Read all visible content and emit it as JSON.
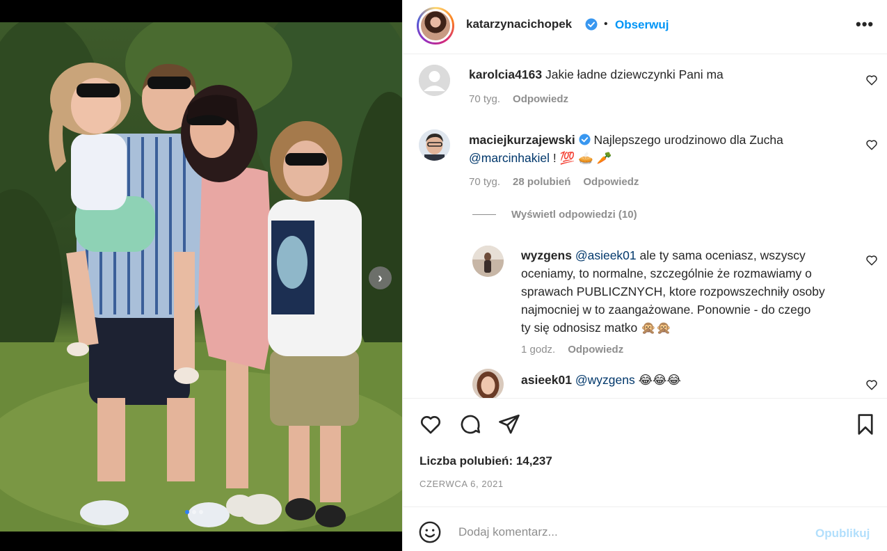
{
  "post": {
    "author": "katarzynacichopek",
    "separator": "•",
    "follow_label": "Obserwuj",
    "more_label": "•••"
  },
  "comments": [
    {
      "user": "karolcia4163",
      "text": "Jakie ładne dziewczynki Pani ma",
      "time": "70 tyg.",
      "reply_label": "Odpowiedz"
    },
    {
      "user": "maciejkurzajewski",
      "verified": true,
      "text_line1": "Najlepszego urodzinowo dla Zucha",
      "mention": "@marcinhakiel",
      "text_after_mention": " ! 💯 🥧 🥕",
      "time": "70 tyg.",
      "likes": "28 polubień",
      "reply_label": "Odpowiedz",
      "view_replies": "Wyświetl odpowiedzi (10)"
    }
  ],
  "replies": [
    {
      "user": "wyzgens",
      "mention": "@asieek01",
      "text_line1": " ale ty sama oceniasz, wszyscy",
      "text_line2": "oceniamy, to normalne, szczególnie że rozmawiamy o",
      "text_line3": "sprawach PUBLICZNYCH, ktore rozpowszechniły osoby",
      "text_line4": "najmocniej w to zaangażowane. Ponownie - do czego",
      "text_line5": "ty się odnosisz matko 🙊🙊",
      "time": "1 godz.",
      "reply_label": "Odpowiedz"
    },
    {
      "user": "asieek01",
      "mention": "@wyzgens",
      "text_after_mention": " 😂😂😂"
    }
  ],
  "stats": {
    "likes_label": "Liczba polubień: 14,237",
    "date": "CZERWCA 6, 2021"
  },
  "comment_box": {
    "placeholder": "Dodaj komentarz...",
    "publish_label": "Opublikuj"
  },
  "colors": {
    "accent": "#0095f6",
    "verified": "#3897f0",
    "muted": "#8e8e8e",
    "publish_disabled": "#b2dffc",
    "carousel_active": "#2f7ff3"
  },
  "icons": {
    "next": "chevron-right-icon",
    "like": "heart-icon",
    "comment": "comment-bubble-icon",
    "share": "paper-plane-icon",
    "save": "bookmark-icon",
    "emoji": "smiley-icon"
  },
  "carousel": {
    "total_slides": 3,
    "active_slide": 1
  }
}
